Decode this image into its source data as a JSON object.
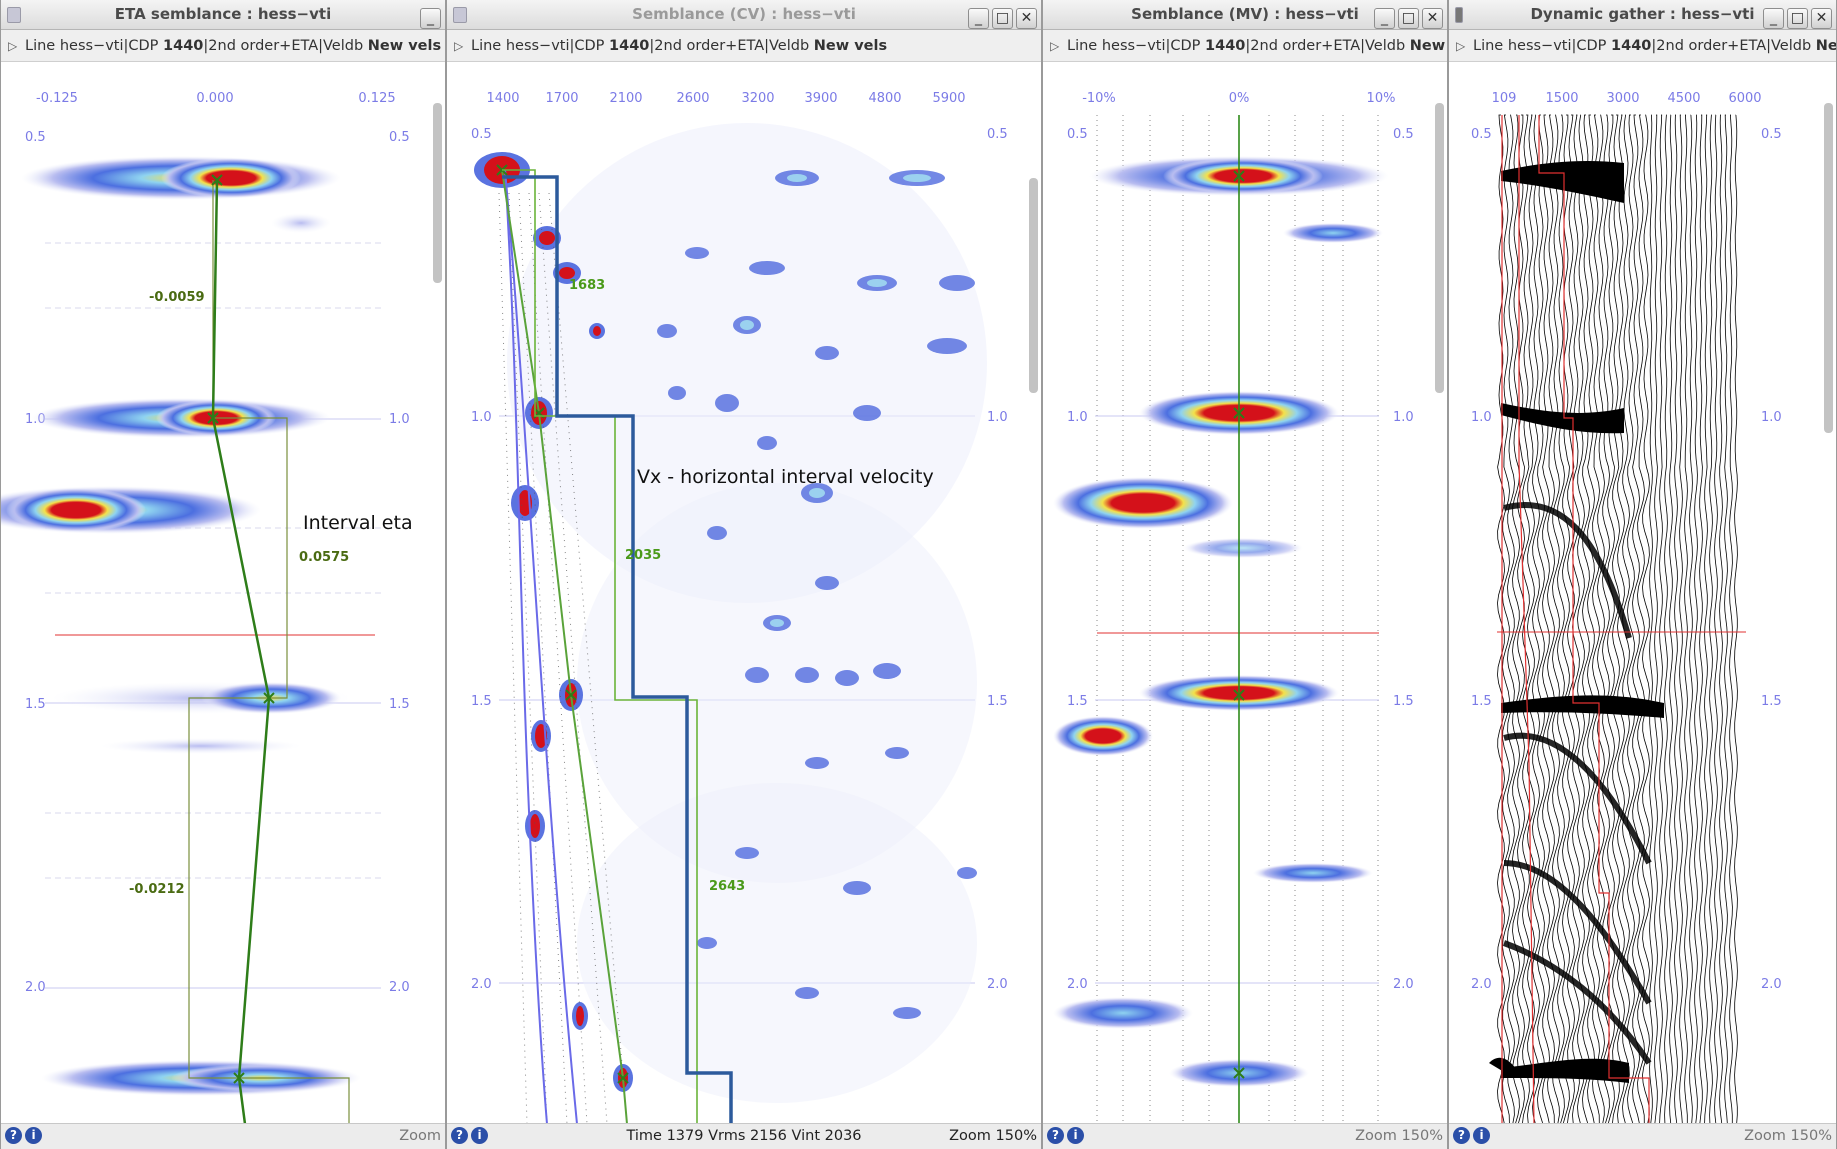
{
  "windows": [
    {
      "title": "ETA semblance : hess−vti",
      "info": {
        "line": "Line hess−vti|CDP ",
        "cdp": "1440",
        "order": "|2nd order+ETA|Veldb ",
        "vels": "New vels"
      },
      "x_ticks": [
        "-0.125",
        "0.000",
        "0.125"
      ],
      "y_ticks": [
        "0.5",
        "1.0",
        "1.5",
        "2.0"
      ],
      "eta_labels": [
        "-0.0059",
        "0.0575",
        "-0.0212"
      ],
      "annotation": "Interval eta",
      "zoom": "Zoom"
    },
    {
      "title": "Semblance (CV) : hess−vti",
      "info": {
        "line": "Line hess−vti|CDP ",
        "cdp": "1440",
        "order": "|2nd order+ETA|Veldb ",
        "vels": "New vels"
      },
      "x_ticks": [
        "1400",
        "1700",
        "2100",
        "2600",
        "3200",
        "3900",
        "4800",
        "5900"
      ],
      "y_ticks": [
        "0.5",
        "1.0",
        "1.5",
        "2.0"
      ],
      "vint_labels": [
        "1683",
        "2035",
        "2643"
      ],
      "annotation": "Vx - horizontal interval velocity",
      "status": "Time 1379 Vrms 2156 Vint 2036",
      "zoom": "Zoom 150%"
    },
    {
      "title": "Semblance (MV) : hess−vti",
      "info": {
        "line": "Line hess−vti|CDP ",
        "cdp": "1440",
        "order": "|2nd order+ETA|Veldb ",
        "vels": "New ..."
      },
      "x_ticks": [
        "-10%",
        "0%",
        "10%"
      ],
      "y_ticks": [
        "0.5",
        "1.0",
        "1.5",
        "2.0"
      ],
      "zoom": "Zoom 150%"
    },
    {
      "title": "Dynamic gather : hess−vti",
      "info": {
        "line": "Line hess−vti|CDP ",
        "cdp": "1440",
        "order": "|2nd order+ETA|Veldb ",
        "vels": "New vels"
      },
      "x_ticks": [
        "109",
        "1500",
        "3000",
        "4500",
        "6000"
      ],
      "y_ticks": [
        "0.5",
        "1.0",
        "1.5",
        "2.0"
      ],
      "zoom": "Zoom 150%"
    }
  ],
  "colors": {
    "peak": "#d4111a",
    "axis": "#7b7be6",
    "pick": "#2e7d19",
    "vint": "#2c5a9c",
    "cursor": "#e03030"
  }
}
